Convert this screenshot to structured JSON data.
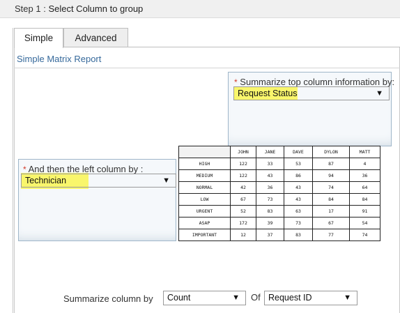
{
  "step": {
    "prefix": "Step 1",
    "separator": " : ",
    "title": "Select Column to group"
  },
  "tabs": [
    {
      "label": "Simple",
      "active": true
    },
    {
      "label": "Advanced",
      "active": false
    }
  ],
  "report_title": "Simple Matrix Report",
  "top_column": {
    "required_mark": "*",
    "label": "Summarize top column information by:",
    "selected": "Request Status"
  },
  "left_column": {
    "required_mark": "*",
    "label": "And then the left column by :",
    "selected": "Technician"
  },
  "matrix": {
    "columns": [
      "JOHN",
      "JANE",
      "DAVE",
      "DYLON",
      "MATT"
    ],
    "rows": [
      {
        "label": "HIGH",
        "values": [
          "122",
          "33",
          "53",
          "87",
          "4"
        ]
      },
      {
        "label": "MEDIUM",
        "values": [
          "122",
          "43",
          "86",
          "94",
          "36"
        ]
      },
      {
        "label": "NORMAL",
        "values": [
          "42",
          "36",
          "43",
          "74",
          "64"
        ]
      },
      {
        "label": "LOW",
        "values": [
          "67",
          "73",
          "43",
          "84",
          "84"
        ]
      },
      {
        "label": "URGENT",
        "values": [
          "52",
          "83",
          "63",
          "17",
          "91"
        ]
      },
      {
        "label": "ASAP",
        "values": [
          "172",
          "39",
          "73",
          "67",
          "54"
        ]
      },
      {
        "label": "IMPORTANT",
        "values": [
          "12",
          "37",
          "83",
          "77",
          "74"
        ]
      }
    ]
  },
  "summarize": {
    "label": "Summarize column by",
    "function": "Count",
    "of_label": "Of",
    "field": "Request ID"
  },
  "icons": {
    "dropdown": "▼"
  },
  "colors": {
    "highlight": "#f9f66c",
    "link_blue": "#36699b",
    "required_red": "#d23a2a"
  }
}
